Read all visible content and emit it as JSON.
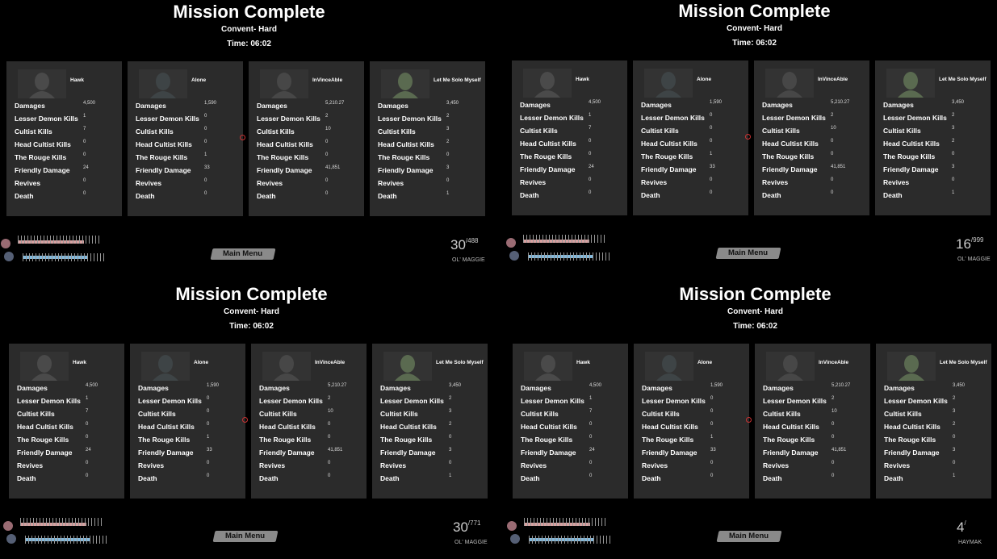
{
  "screen": {
    "title": "Mission Complete",
    "mission": "Convent- Hard",
    "time": "Time:  06:02",
    "main_menu_label": "Main Menu"
  },
  "columns": [
    "Damages",
    "Lesser Demon Kills",
    "Cultist Kills",
    "Head Cultist Kills",
    "The Rouge Kills",
    "Friendly Damage",
    "Revives",
    "Death"
  ],
  "players": [
    {
      "name": "Hawk",
      "values": [
        "4,500",
        "1",
        "7",
        "0",
        "0",
        "24",
        "0",
        "0"
      ],
      "portrait_color": "#4a4a4a"
    },
    {
      "name": "Alone",
      "values": [
        "1,590",
        "0",
        "0",
        "0",
        "1",
        "33",
        "0",
        "0"
      ],
      "portrait_color": "#3e4446"
    },
    {
      "name": "InVinceAble",
      "values": [
        "5,210.27",
        "2",
        "10",
        "0",
        "0",
        "41,851",
        "0",
        "0"
      ],
      "portrait_color": "#474747"
    },
    {
      "name": "Let Me Solo Myself",
      "values": [
        "3,450",
        "2",
        "3",
        "2",
        "0",
        "3",
        "0",
        "1"
      ],
      "portrait_color": "#5a6a50"
    }
  ],
  "quadrants": [
    {
      "ammo": "30",
      "ammo_reserve": "488",
      "weapon": "OL' MAGGIE"
    },
    {
      "ammo": "16",
      "ammo_reserve": "999",
      "weapon": "OL' MAGGIE"
    },
    {
      "ammo": "30",
      "ammo_reserve": "771",
      "weapon": "OL' MAGGIE"
    },
    {
      "ammo": "4",
      "ammo_reserve": "",
      "weapon": "HAYMAK"
    }
  ],
  "colors": {
    "background": "#000000",
    "card": "#2b2b2b",
    "health": "#d7a0a0",
    "armor": "#83b9dc",
    "button": "#8a8a8a"
  }
}
